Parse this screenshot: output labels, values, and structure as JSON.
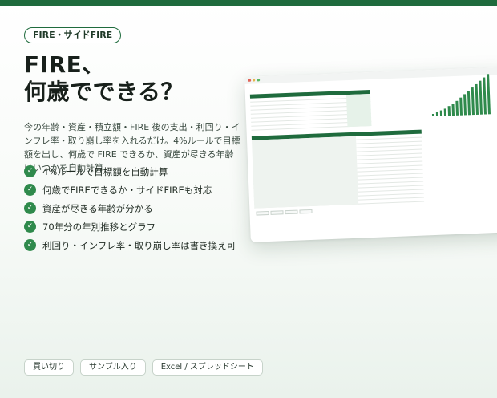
{
  "brand": {
    "accent": "#1f6b3d",
    "check": "#2f8a4c"
  },
  "tag": "FIRE・サイドFIRE",
  "headline": {
    "line1": "FIRE、",
    "line2": "何歳でできる？"
  },
  "lead": "今の年齢・資産・積立額・FIRE 後の支出・利回り・インフレ率・取り崩し率を入れるだけ。4%ルールで目標額を出し、何歳で FIRE できるか、資産が尽きる年齢はいつかを自動計算",
  "features": [
    "4%ルールで目標額を自動計算",
    "何歳でFIREできるか・サイドFIREも対応",
    "資産が尽きる年齢が分かる",
    "70年分の年別推移とグラフ",
    "利回り・インフレ率・取り崩し率は書き換え可"
  ],
  "bottom_pills": [
    "買い切り",
    "サンプル入り",
    "Excel / スプレッドシート"
  ],
  "icons": {
    "feature": "check-circle-icon"
  }
}
